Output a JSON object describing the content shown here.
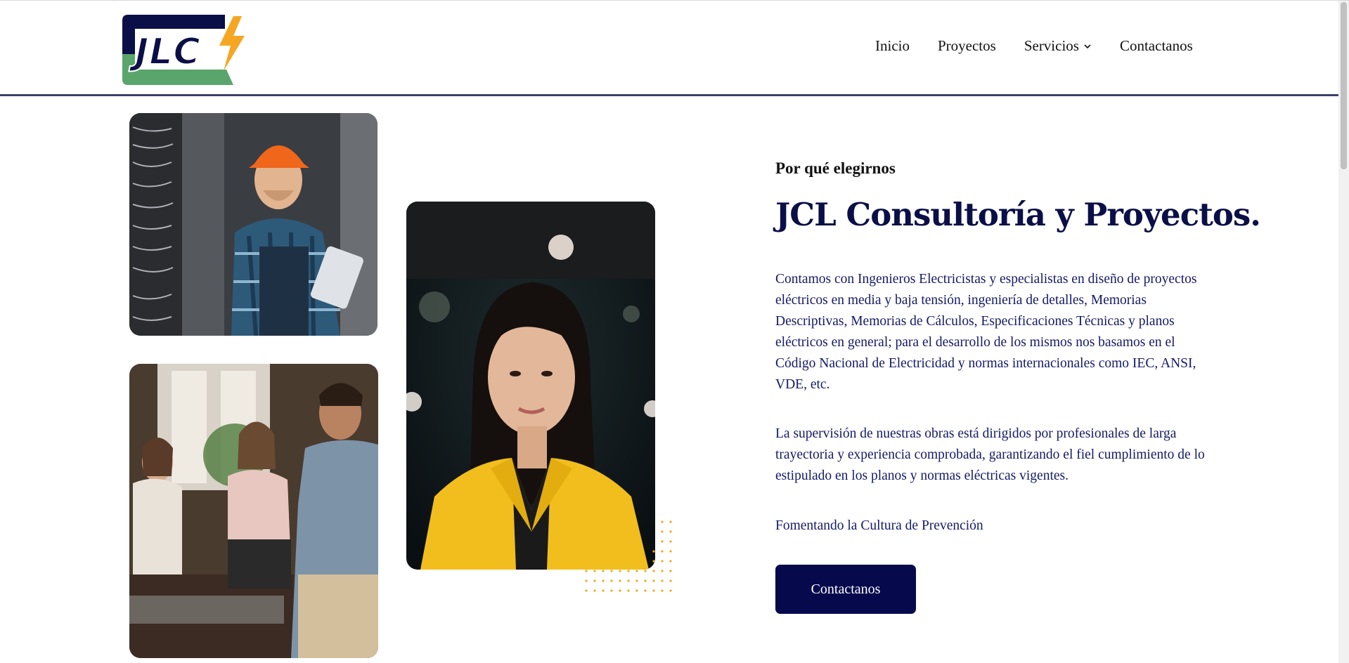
{
  "brand": {
    "logo_text": "JLC",
    "primary": "#0b0f47",
    "green": "#5aa56b",
    "bolt": "#f5a623"
  },
  "nav": {
    "items": [
      {
        "label": "Inicio"
      },
      {
        "label": "Proyectos"
      },
      {
        "label": "Servicios",
        "has_dropdown": true
      },
      {
        "label": "Contactanos"
      }
    ]
  },
  "about": {
    "eyebrow": "Por qué elegirnos",
    "title": "JCL Consultoría y Proyectos.",
    "paragraph_1": "Contamos con Ingenieros Electricistas y especialistas en diseño de proyectos eléctricos en media y baja tensión, ingeniería de detalles, Memorias Descriptivas, Memorias de Cálculos, Especificaciones Técnicas y planos eléctricos en general; para el desarrollo de los mismos nos basamos en el Código Nacional de Electricidad y normas internacionales como IEC, ANSI, VDE, etc.",
    "paragraph_2": "La supervisión de nuestras obras está dirigidos por profesionales de larga trayectoria y experiencia comprobada, garantizando el fiel cumplimiento de lo estipulado en los planos y normas eléctricas vigentes.",
    "paragraph_3": "Fomentando la Cultura de Prevención",
    "cta_label": "Contactanos"
  },
  "images": {
    "worker": "electrician-with-helmet-photo",
    "meeting": "team-meeting-photo",
    "woman": "professional-woman-portrait-photo"
  }
}
